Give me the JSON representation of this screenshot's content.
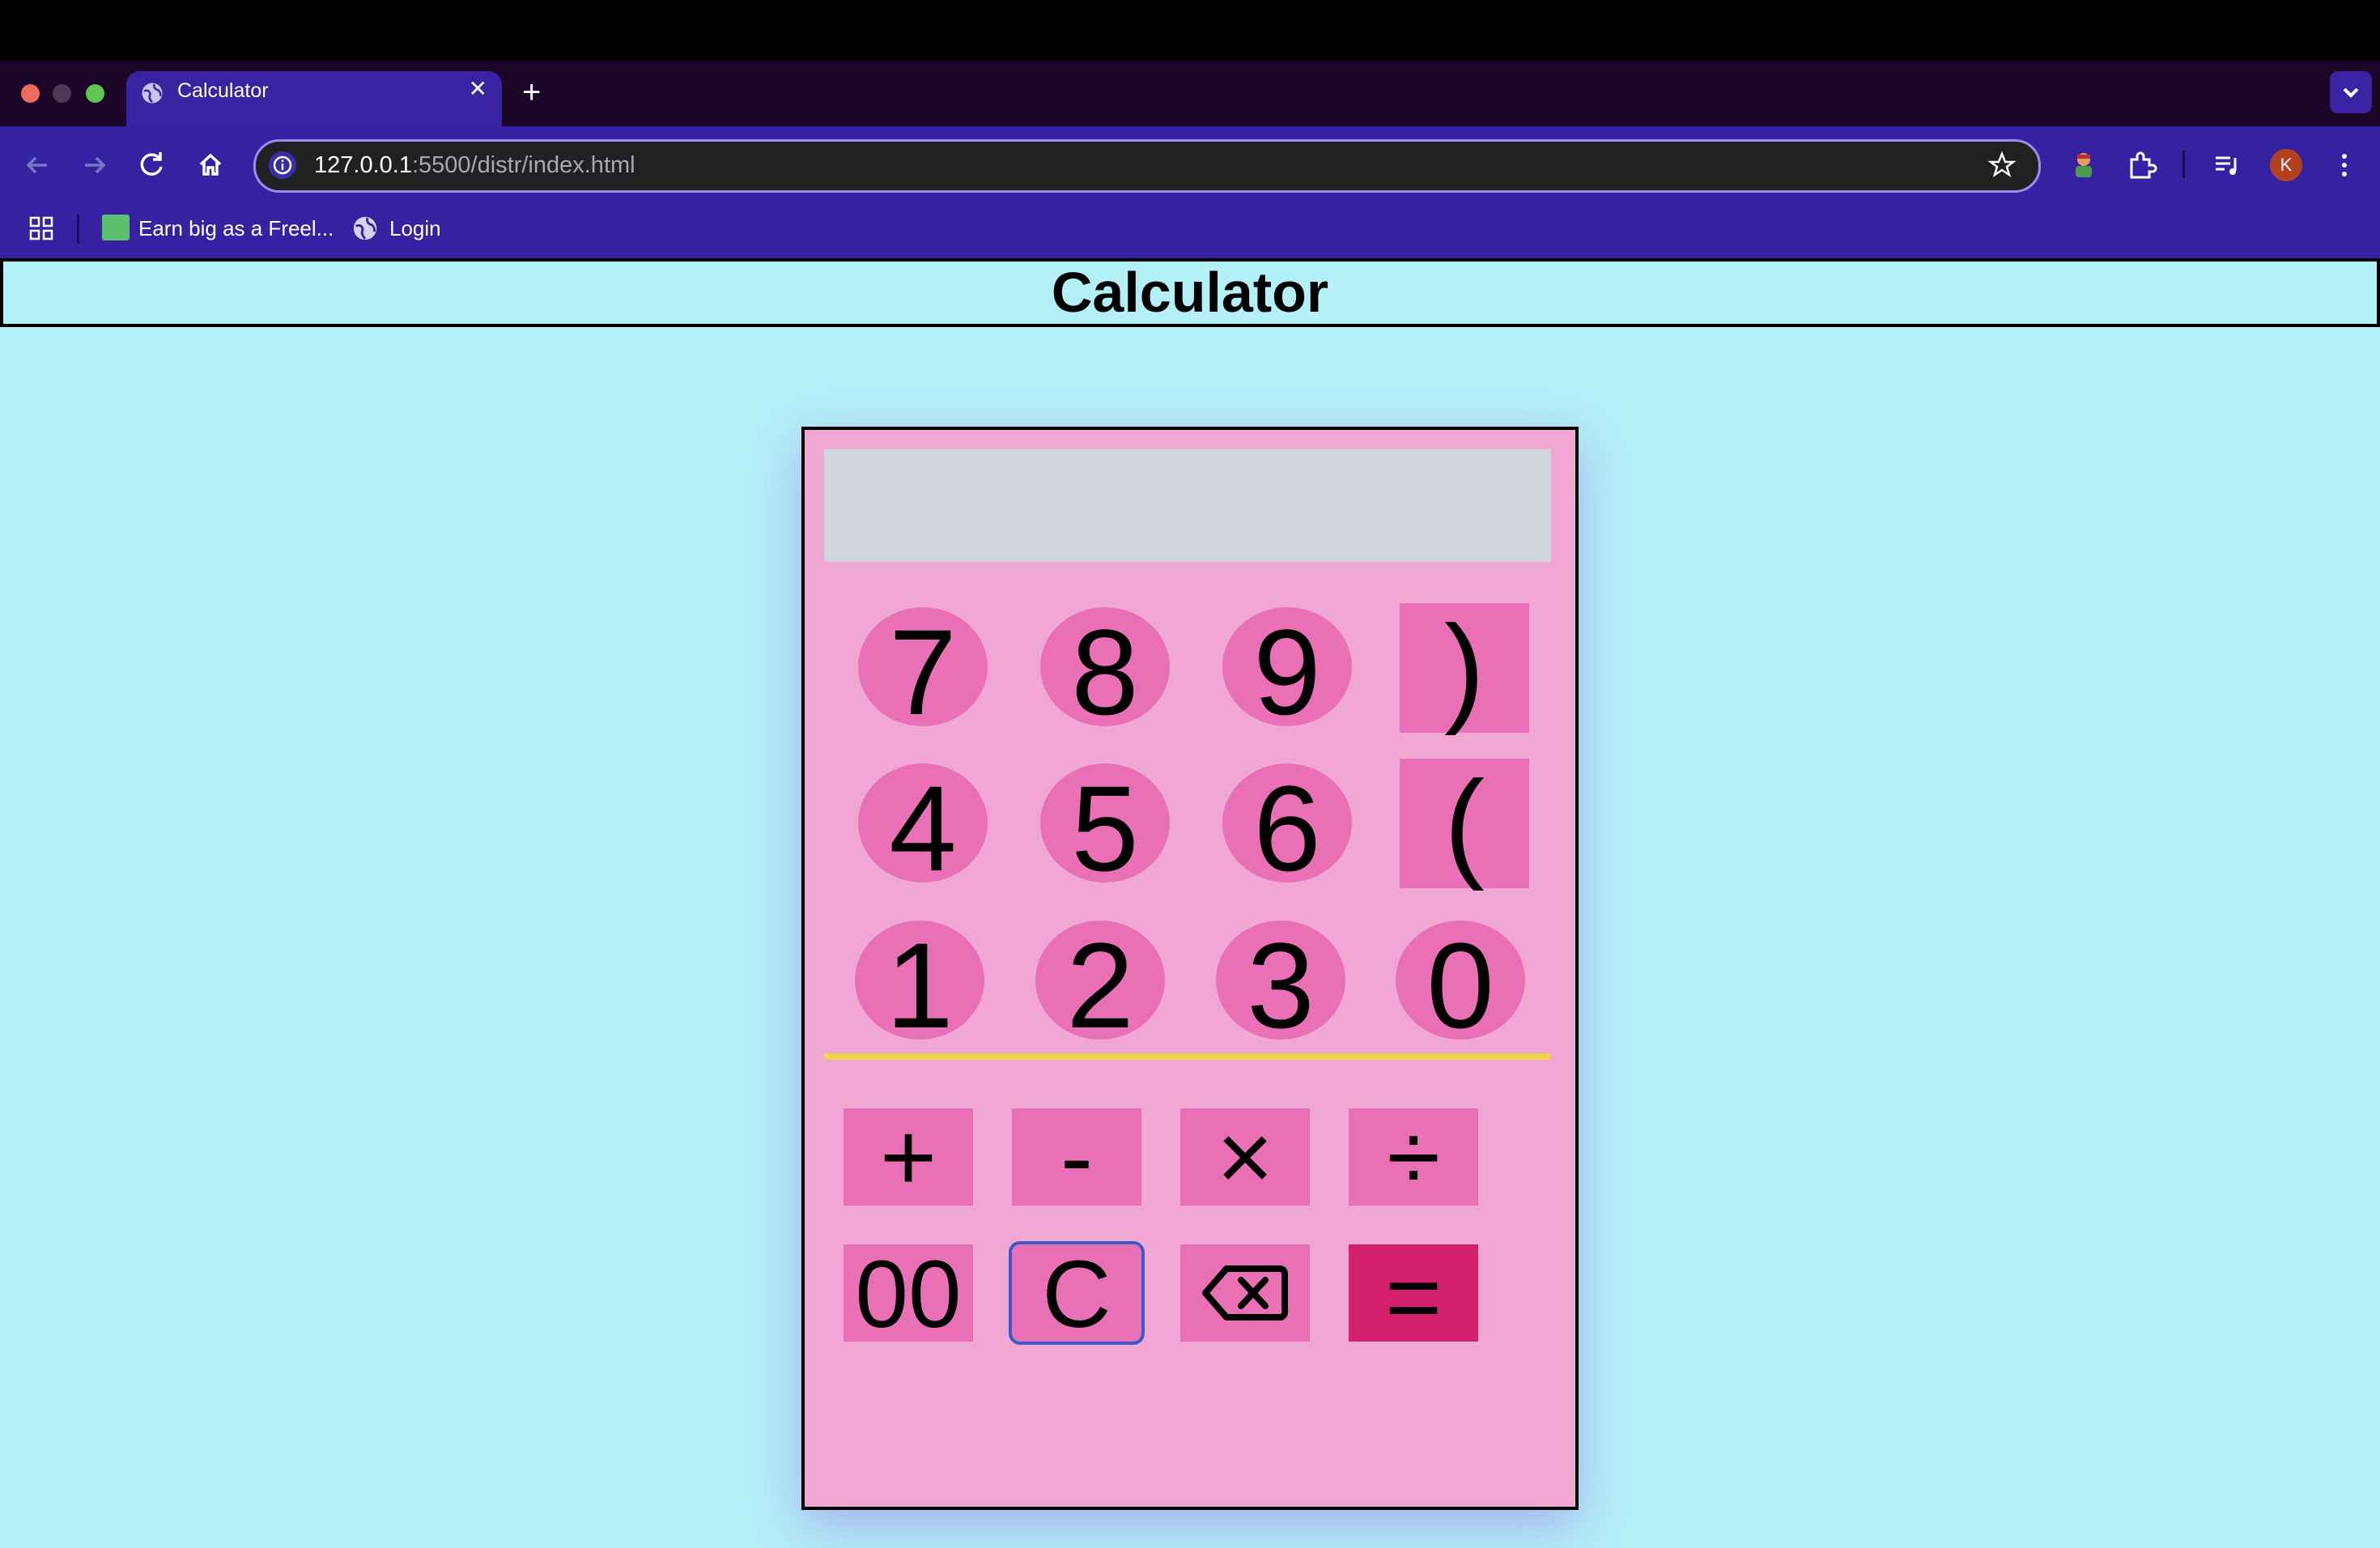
{
  "browser": {
    "tab_title": "Calculator",
    "url_host": "127.0.0.1",
    "url_rest": ":5500/distr/index.html",
    "bookmarks": [
      "Earn big as a Freel...",
      "Login"
    ],
    "profile_initial": "K",
    "new_tab_label": "+",
    "close_tab_label": "✕"
  },
  "page": {
    "title": "Calculator"
  },
  "calculator": {
    "display": "",
    "digits_row1": [
      "7",
      "8",
      "9"
    ],
    "digits_row2": [
      "4",
      "5",
      "6"
    ],
    "digits_row3": [
      "1",
      "2",
      "3",
      "0"
    ],
    "paren_close": ")",
    "paren_open": "(",
    "operators": [
      "+",
      "-",
      "×",
      "÷"
    ],
    "double_zero": "00",
    "clear": "C",
    "backspace_icon": "backspace-icon",
    "equals": "="
  },
  "colors": {
    "page_bg": "#b4f0f8",
    "calc_bg": "#f1a7d3",
    "key": "#ea70b6",
    "equals_key": "#d3206f",
    "display_bg": "#d1d6de",
    "divider": "#f2d24a",
    "toolbar": "#3422a3"
  }
}
